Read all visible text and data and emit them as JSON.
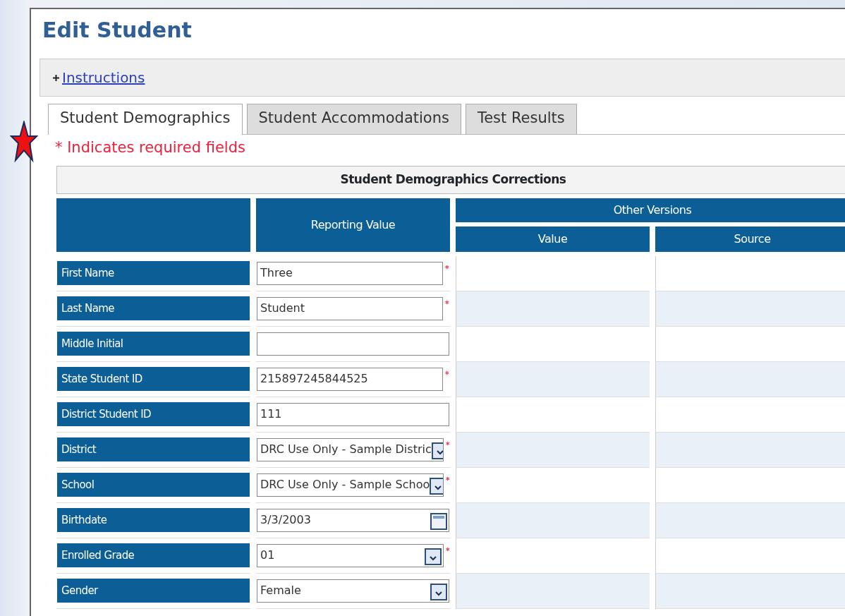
{
  "title": "Edit Student",
  "instructions": {
    "label": "Instructions",
    "expanded": false
  },
  "tabs": [
    {
      "label": "Student Demographics",
      "selected": true
    },
    {
      "label": "Student Accommodations",
      "selected": false
    },
    {
      "label": "Test Results",
      "selected": false
    }
  ],
  "required_note": "* Indicates required fields",
  "table": {
    "caption": "Student Demographics Corrections",
    "header_reporting": "Reporting Value",
    "header_other": "Other Versions",
    "header_value": "Value",
    "header_source": "Source",
    "rows": [
      {
        "label": "First Name",
        "kind": "text",
        "value": "Three",
        "required": true
      },
      {
        "label": "Last Name",
        "kind": "text",
        "value": "Student",
        "required": true
      },
      {
        "label": "Middle Initial",
        "kind": "text",
        "value": "",
        "required": false
      },
      {
        "label": "State Student ID",
        "kind": "text",
        "value": "215897245844525",
        "required": true
      },
      {
        "label": "District Student ID",
        "kind": "text",
        "value": "111",
        "required": false
      },
      {
        "label": "District",
        "kind": "select",
        "value": "DRC Use Only - Sample Distric",
        "required": true
      },
      {
        "label": "School",
        "kind": "select",
        "value": "DRC Use Only - Sample Schoo",
        "required": true
      },
      {
        "label": "Birthdate",
        "kind": "date",
        "value": "3/3/2003",
        "required": false
      },
      {
        "label": "Enrolled Grade",
        "kind": "select",
        "value": "01",
        "required": true
      },
      {
        "label": "Gender",
        "kind": "select",
        "value": "Female",
        "required": false
      }
    ]
  }
}
